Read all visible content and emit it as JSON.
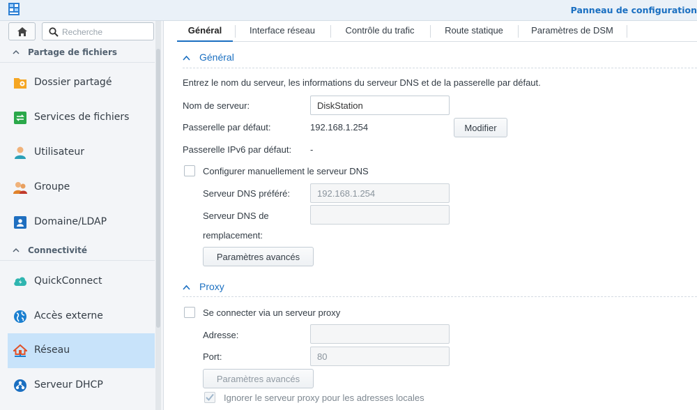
{
  "window": {
    "title": "Panneau de configuration"
  },
  "sidebar": {
    "search_placeholder": "Recherche",
    "sections": [
      {
        "label": "Partage de fichiers"
      },
      {
        "label": "Connectivité"
      }
    ],
    "items": [
      {
        "label": "Dossier partagé",
        "icon": "shared-folder-icon",
        "color": "#f5a623"
      },
      {
        "label": "Services de fichiers",
        "icon": "file-services-icon",
        "color": "#2aa84a"
      },
      {
        "label": "Utilisateur",
        "icon": "user-icon",
        "color": "#2aa0b8"
      },
      {
        "label": "Groupe",
        "icon": "group-icon",
        "color": "#e0822a"
      },
      {
        "label": "Domaine/LDAP",
        "icon": "domain-ldap-icon",
        "color": "#1f6fc0"
      },
      {
        "label": "QuickConnect",
        "icon": "quickconnect-icon",
        "color": "#2fb5b0"
      },
      {
        "label": "Accès externe",
        "icon": "globe-icon",
        "color": "#1a7fd0"
      },
      {
        "label": "Réseau",
        "icon": "network-home-icon",
        "color": "#e0522a",
        "active": true
      },
      {
        "label": "Serveur DHCP",
        "icon": "dhcp-icon",
        "color": "#1a6fc1"
      }
    ]
  },
  "tabs": [
    {
      "label": "Général",
      "active": true
    },
    {
      "label": "Interface réseau"
    },
    {
      "label": "Contrôle du trafic"
    },
    {
      "label": "Route statique"
    },
    {
      "label": "Paramètres de DSM"
    }
  ],
  "general": {
    "title": "Général",
    "description": "Entrez le nom du serveur, les informations du serveur DNS et de la passerelle par défaut.",
    "server_name_label": "Nom de serveur:",
    "server_name_value": "DiskStation",
    "gateway_label": "Passerelle par défaut:",
    "gateway_value": "192.168.1.254",
    "modify_button": "Modifier",
    "ipv6_gateway_label": "Passerelle IPv6 par défaut:",
    "ipv6_gateway_value": "-",
    "manual_dns_label": "Configurer manuellement le serveur DNS",
    "manual_dns_checked": false,
    "preferred_dns_label": "Serveur DNS préféré:",
    "preferred_dns_value": "192.168.1.254",
    "alternate_dns_label_1": "Serveur DNS de",
    "alternate_dns_label_2": "remplacement:",
    "alternate_dns_value": "",
    "advanced_button": "Paramètres avancés"
  },
  "proxy": {
    "title": "Proxy",
    "connect_label": "Se connecter via un serveur proxy",
    "connect_checked": false,
    "address_label": "Adresse:",
    "address_value": "",
    "port_label": "Port:",
    "port_value": "80",
    "advanced_button": "Paramètres avancés",
    "bypass_label": "Ignorer le serveur proxy pour les adresses locales",
    "bypass_checked": true
  },
  "colors": {
    "accent": "#1a6fc1",
    "active_item_bg": "#c8e3fa"
  }
}
